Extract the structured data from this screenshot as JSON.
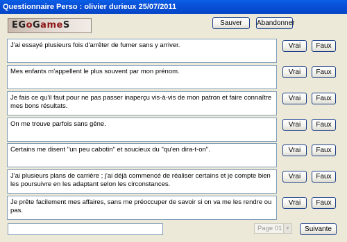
{
  "window": {
    "title": "Questionnaire Perso : olivier durieux 25/07/2011"
  },
  "logo": {
    "part1": "EG",
    "part2": "o",
    "part3": "G",
    "part4": "ame",
    "part5": "S"
  },
  "toolbar": {
    "save_label": "Sauver",
    "abandon_label": "Abandonner"
  },
  "questions": [
    {
      "text": "J'ai essayé plusieurs fois d'arrêter de fumer sans y arriver.",
      "true_label": "Vrai",
      "false_label": "Faux"
    },
    {
      "text": "Mes enfants m'appellent le plus souvent par mon prénom.",
      "true_label": "Vrai",
      "false_label": "Faux"
    },
    {
      "text": "Je fais ce qu'il faut pour ne pas passer inaperçu vis-à-vis de mon patron et faire connaître mes bons résultats.",
      "true_label": "Vrai",
      "false_label": "Faux"
    },
    {
      "text": "On me trouve parfois sans gêne.",
      "true_label": "Vrai",
      "false_label": "Faux"
    },
    {
      "text": "Certains me disent \"un peu cabotin\" et soucieux du \"qu'en dira-t-on\".",
      "true_label": "Vrai",
      "false_label": "Faux"
    },
    {
      "text": "J'ai plusieurs plans de carrière ; j'ai déjà commencé de réaliser certains et je compte bien les poursuivre en les adaptant selon les circonstances.",
      "true_label": "Vrai",
      "false_label": "Faux"
    },
    {
      "text": "Je prête facilement mes affaires, sans me préoccuper de savoir si on va me les rendre ou pas.",
      "true_label": "Vrai",
      "false_label": "Faux"
    }
  ],
  "footer": {
    "input_value": "",
    "page_select_value": "Page 01",
    "next_label": "Suivante"
  }
}
